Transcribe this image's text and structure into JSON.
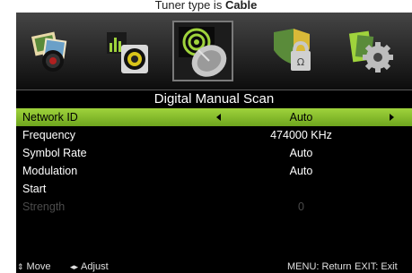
{
  "caption": {
    "prefix": "Tuner type is ",
    "bold": "Cable"
  },
  "icons": [
    {
      "name": "picture-icon"
    },
    {
      "name": "sound-icon"
    },
    {
      "name": "channel-icon",
      "selected": true
    },
    {
      "name": "lock-icon"
    },
    {
      "name": "setup-icon"
    }
  ],
  "menu": {
    "title": "Digital Manual Scan",
    "rows": [
      {
        "label": "Network ID",
        "value": "Auto"
      },
      {
        "label": "Frequency",
        "value": "474000 KHz"
      },
      {
        "label": "Symbol Rate",
        "value": "Auto"
      },
      {
        "label": "Modulation",
        "value": "Auto"
      },
      {
        "label": "Start",
        "value": ""
      },
      {
        "label": "Strength",
        "value": "0"
      }
    ]
  },
  "footer": {
    "move": "Move",
    "adjust": "Adjust",
    "menu_hint": "MENU: Return",
    "exit_hint": "EXIT: Exit"
  },
  "colors": {
    "highlight": "#8cc63f",
    "background": "#000000",
    "disabled_text": "#4b4b4b"
  }
}
